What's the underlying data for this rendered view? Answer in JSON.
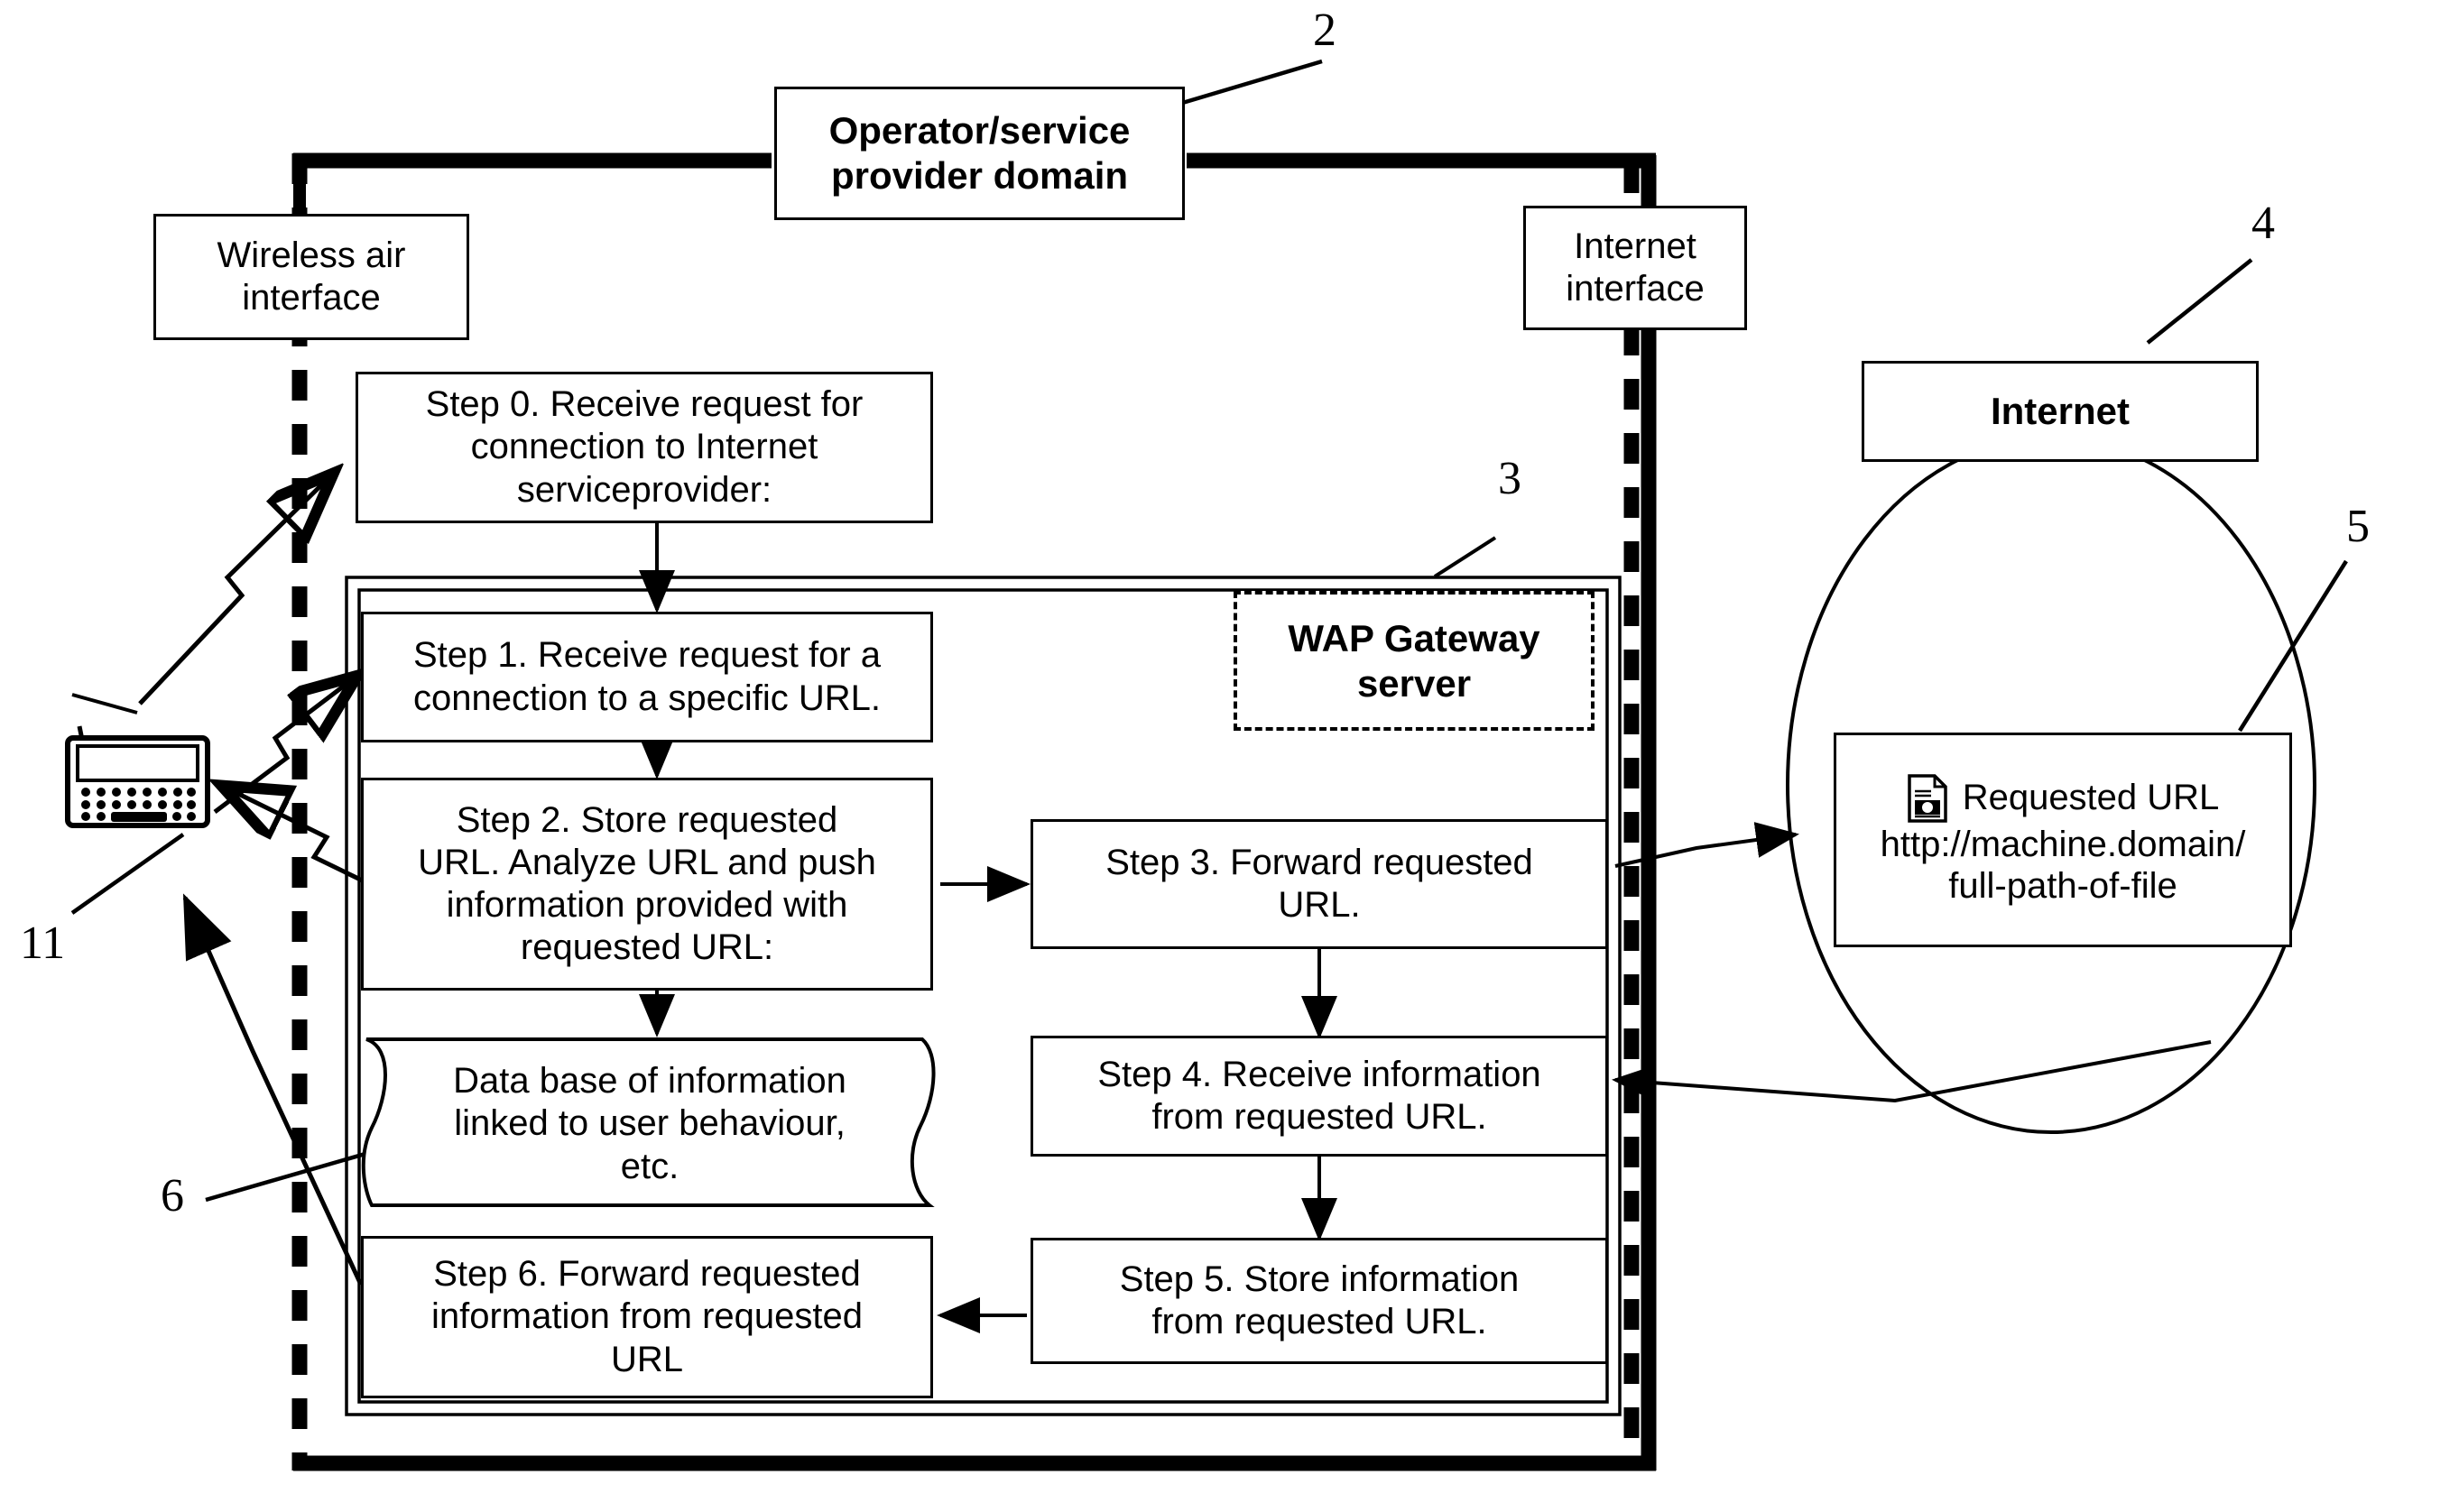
{
  "figure": {
    "type": "patent-flow-diagram",
    "domain_box": {
      "label": "Operator/service\nprovider domain"
    },
    "interfaces": {
      "wireless": "Wireless air\ninterface",
      "internet": "Internet\ninterface"
    },
    "gateway": {
      "label": "WAP Gateway\nserver"
    },
    "internet_cloud": {
      "label": "Internet"
    },
    "requested_url": {
      "title": "Requested  URL",
      "url_line1": "http://machine.domain/",
      "url_line2": "full-path-of-file",
      "icon": "document-icon"
    },
    "steps": [
      {
        "id": "step0",
        "text": "Step 0. Receive request for\nconnection to Internet\nserviceprovider:"
      },
      {
        "id": "step1",
        "text": "Step 1. Receive request for a\nconnection to a specific URL."
      },
      {
        "id": "step2",
        "text": "Step 2. Store requested\nURL. Analyze URL and push\ninformation provided with\nrequested URL:"
      },
      {
        "id": "database",
        "text": "Data base of information\nlinked to user behaviour,\netc."
      },
      {
        "id": "step6",
        "text": "Step 6. Forward requested\ninformation from requested\nURL"
      },
      {
        "id": "step3",
        "text": "Step 3. Forward requested\nURL."
      },
      {
        "id": "step4",
        "text": "Step 4. Receive information\nfrom requested URL."
      },
      {
        "id": "step5",
        "text": "Step 5. Store information\nfrom requested URL."
      }
    ],
    "reference_numerals": [
      {
        "id": "ref2",
        "label": "2",
        "points_to": "operator-service-provider-domain"
      },
      {
        "id": "ref3",
        "label": "3",
        "points_to": "wap-gateway-container"
      },
      {
        "id": "ref4",
        "label": "4",
        "points_to": "internet-box"
      },
      {
        "id": "ref5",
        "label": "5",
        "points_to": "requested-url-box"
      },
      {
        "id": "ref6",
        "label": "6",
        "points_to": "database-box"
      },
      {
        "id": "ref11",
        "label": "11",
        "points_to": "mobile-terminal"
      }
    ],
    "mobile_terminal": {
      "icon": "pda-device-icon"
    },
    "colors": {
      "ink": "#000000",
      "paper": "#ffffff"
    }
  }
}
